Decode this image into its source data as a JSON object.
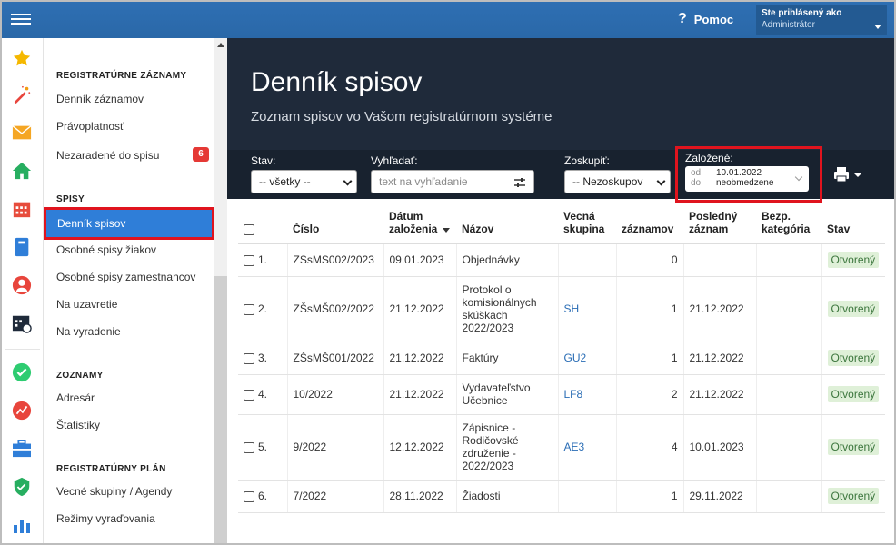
{
  "topbar": {
    "help_label": "Pomoc",
    "user_line1": "Ste prihlásený ako",
    "user_line2": "Administrátor"
  },
  "iconbar": [
    "star-icon",
    "magic-wand-icon",
    "mail-icon",
    "home-icon",
    "calendar-icon",
    "book-icon",
    "person-icon",
    "calendar-clock-icon",
    "check-circle-icon",
    "chart-badge-icon",
    "briefcase-icon",
    "shield-check-icon",
    "bar-chart-icon"
  ],
  "sidebar": {
    "sec1": "REGISTRATÚRNE ZÁZNAMY",
    "item_dennik_zaznamov": "Denník záznamov",
    "item_pravoplatnost": "Právoplatnosť",
    "item_nezaradene": "Nezaradené do spisu",
    "badge": "6",
    "sec2": "SPISY",
    "item_dennik_spisov": "Denník spisov",
    "item_ziakov": "Osobné spisy žiakov",
    "item_zamestnancov": "Osobné spisy zamestnancov",
    "item_uzavretie": "Na uzavretie",
    "item_vyradenie": "Na vyradenie",
    "sec3": "ZOZNAMY",
    "item_adresar": "Adresár",
    "item_statistiky": "Štatistiky",
    "sec4": "REGISTRATÚRNY PLÁN",
    "item_vecne": "Vecné skupiny / Agendy",
    "item_rezimy": "Režimy vyraďovania"
  },
  "main": {
    "title": "Denník spisov",
    "subtitle": "Zoznam spisov vo Vašom registratúrnom systéme"
  },
  "filters": {
    "stav_label": "Stav:",
    "stav_value": "-- všetky --",
    "vyhladat_label": "Vyhľadať:",
    "search_placeholder": "text na vyhľadanie",
    "zoskupit_label": "Zoskupiť:",
    "zoskupit_value": "-- Nezoskupov",
    "zalozene_label": "Založené:",
    "od_label": "od:",
    "od_value": "10.01.2022",
    "do_label": "do:",
    "do_value": "neobmedzene"
  },
  "table": {
    "headers": {
      "cislo": "Číslo",
      "datum": "Dátum založenia",
      "nazov": "Názov",
      "vecna": "Vecná skupina",
      "zaznamov": "záznamov",
      "posledny": "Posledný záznam",
      "bezp": "Bezp. kategória",
      "stav": "Stav"
    },
    "rows": [
      {
        "n": "1.",
        "cislo": "ZSsMS002/2023",
        "datum": "09.01.2023",
        "nazov": "Objednávky",
        "vecna": "",
        "zaznamov": "0",
        "posledny": "",
        "stav": "Otvorený"
      },
      {
        "n": "2.",
        "cislo": "ZŠsMŠ002/2022",
        "datum": "21.12.2022",
        "nazov": "Protokol o komisionálnych skúškach 2022/2023",
        "vecna": "SH",
        "zaznamov": "1",
        "posledny": "21.12.2022",
        "stav": "Otvorený"
      },
      {
        "n": "3.",
        "cislo": "ZŠsMŠ001/2022",
        "datum": "21.12.2022",
        "nazov": "Faktúry",
        "vecna": "GU2",
        "zaznamov": "1",
        "posledny": "21.12.2022",
        "stav": "Otvorený"
      },
      {
        "n": "4.",
        "cislo": "10/2022",
        "datum": "21.12.2022",
        "nazov": "Vydavateľstvo Učebnice",
        "vecna": "LF8",
        "zaznamov": "2",
        "posledny": "21.12.2022",
        "stav": "Otvorený"
      },
      {
        "n": "5.",
        "cislo": "9/2022",
        "datum": "12.12.2022",
        "nazov": "Zápisnice - Rodičovské združenie - 2022/2023",
        "vecna": "AE3",
        "zaznamov": "4",
        "posledny": "10.01.2023",
        "stav": "Otvorený"
      },
      {
        "n": "6.",
        "cislo": "7/2022",
        "datum": "28.11.2022",
        "nazov": "Žiadosti",
        "vecna": "",
        "zaznamov": "1",
        "posledny": "29.11.2022",
        "stav": "Otvorený"
      }
    ]
  }
}
